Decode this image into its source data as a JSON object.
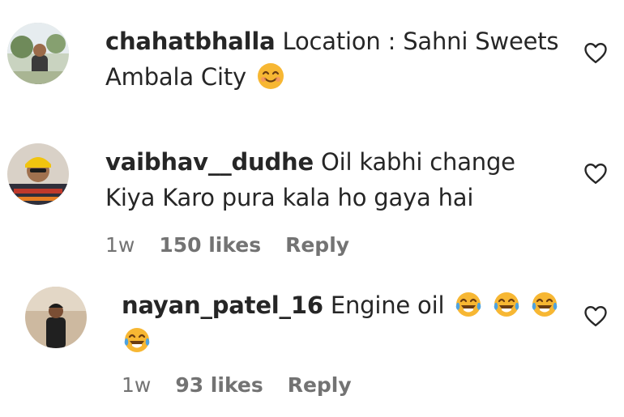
{
  "comments": [
    {
      "username": "chahatbhalla",
      "text": "Location : Sahni Sweets Ambala City",
      "emoji": "smiling-face-icon"
    },
    {
      "username": "vaibhav__dudhe",
      "text": "Oil kabhi change Kiya Karo pura kala ho gaya hai",
      "time": "1w",
      "likes": "150 likes",
      "reply": "Reply"
    },
    {
      "username": "nayan_patel_16",
      "text": "Engine oil",
      "emoji": "tears-of-joy-icon",
      "time": "1w",
      "likes": "93 likes",
      "reply": "Reply"
    }
  ],
  "colors": {
    "text": "#262626",
    "meta": "#737373",
    "emoji_yellow": "#f7b733"
  }
}
